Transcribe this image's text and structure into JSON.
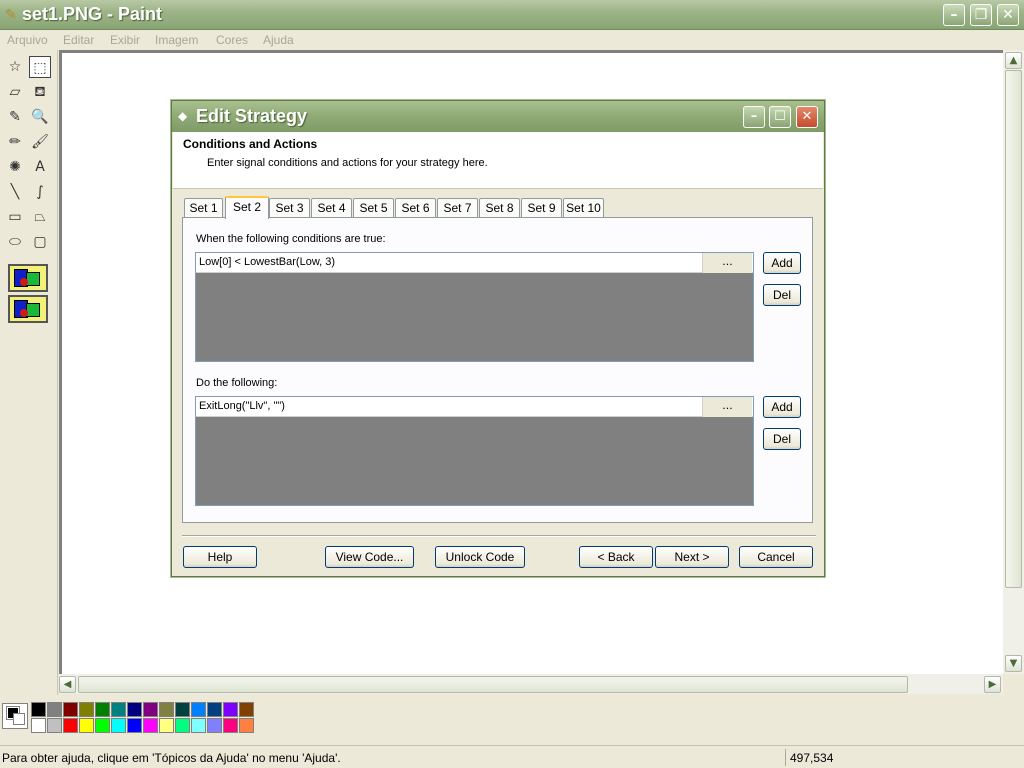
{
  "window": {
    "title": "set1.PNG - Paint",
    "app_icon": "paint-icon",
    "controls": [
      "minimize",
      "maximize",
      "close"
    ]
  },
  "menu": {
    "items": [
      "Arquivo",
      "Editar",
      "Exibir",
      "Imagem",
      "Cores",
      "Ajuda"
    ]
  },
  "toolbox": {
    "tools": [
      {
        "name": "free-select-icon",
        "glyph": "☆"
      },
      {
        "name": "rect-select-icon",
        "glyph": "⬚"
      },
      {
        "name": "eraser-icon",
        "glyph": "▱"
      },
      {
        "name": "fill-icon",
        "glyph": "⛾"
      },
      {
        "name": "color-picker-icon",
        "glyph": "✎"
      },
      {
        "name": "magnifier-icon",
        "glyph": "🔍"
      },
      {
        "name": "pencil-icon",
        "glyph": "✏"
      },
      {
        "name": "brush-icon",
        "glyph": "🖌"
      },
      {
        "name": "airbrush-icon",
        "glyph": "✺"
      },
      {
        "name": "text-icon",
        "glyph": "A"
      },
      {
        "name": "line-icon",
        "glyph": "╲"
      },
      {
        "name": "curve-icon",
        "glyph": "∫"
      },
      {
        "name": "rectangle-icon",
        "glyph": "▭"
      },
      {
        "name": "polygon-icon",
        "glyph": "⏢"
      },
      {
        "name": "ellipse-icon",
        "glyph": "⬭"
      },
      {
        "name": "rounded-rect-icon",
        "glyph": "▢"
      }
    ]
  },
  "dialog": {
    "title": "Edit Strategy",
    "header_title": "Conditions and Actions",
    "header_subtitle": "Enter signal conditions and actions for your strategy here.",
    "tabs": [
      "Set 1",
      "Set 2",
      "Set 3",
      "Set 4",
      "Set 5",
      "Set 6",
      "Set 7",
      "Set 8",
      "Set 9",
      "Set 10"
    ],
    "active_tab": "Set 2",
    "conditions_label": "When the following conditions are true:",
    "condition_value": "Low[0] < LowestBar(Low, 3)",
    "actions_label": "Do the following:",
    "action_value": "ExitLong(\"Llv\", \"\")",
    "ellipsis": "...",
    "add_label": "Add",
    "del_label": "Del",
    "help_label": "Help",
    "view_code_label": "View Code...",
    "unlock_code_label": "Unlock Code",
    "back_label": "< Back",
    "next_label": "Next >",
    "cancel_label": "Cancel"
  },
  "palette": {
    "colors": [
      "#000000",
      "#808080",
      "#800000",
      "#808000",
      "#008000",
      "#008080",
      "#000080",
      "#800080",
      "#808040",
      "#004040",
      "#0080ff",
      "#004080",
      "#8000ff",
      "#804000",
      "#ffffff",
      "#c0c0c0",
      "#ff0000",
      "#ffff00",
      "#00ff00",
      "#00ffff",
      "#0000ff",
      "#ff00ff",
      "#ffff80",
      "#00ff80",
      "#80ffff",
      "#8080ff",
      "#ff0080",
      "#ff8040"
    ]
  },
  "status": {
    "message": "Para obter ajuda, clique em 'Tópicos da Ajuda' no menu 'Ajuda'.",
    "coords": "497,534"
  }
}
